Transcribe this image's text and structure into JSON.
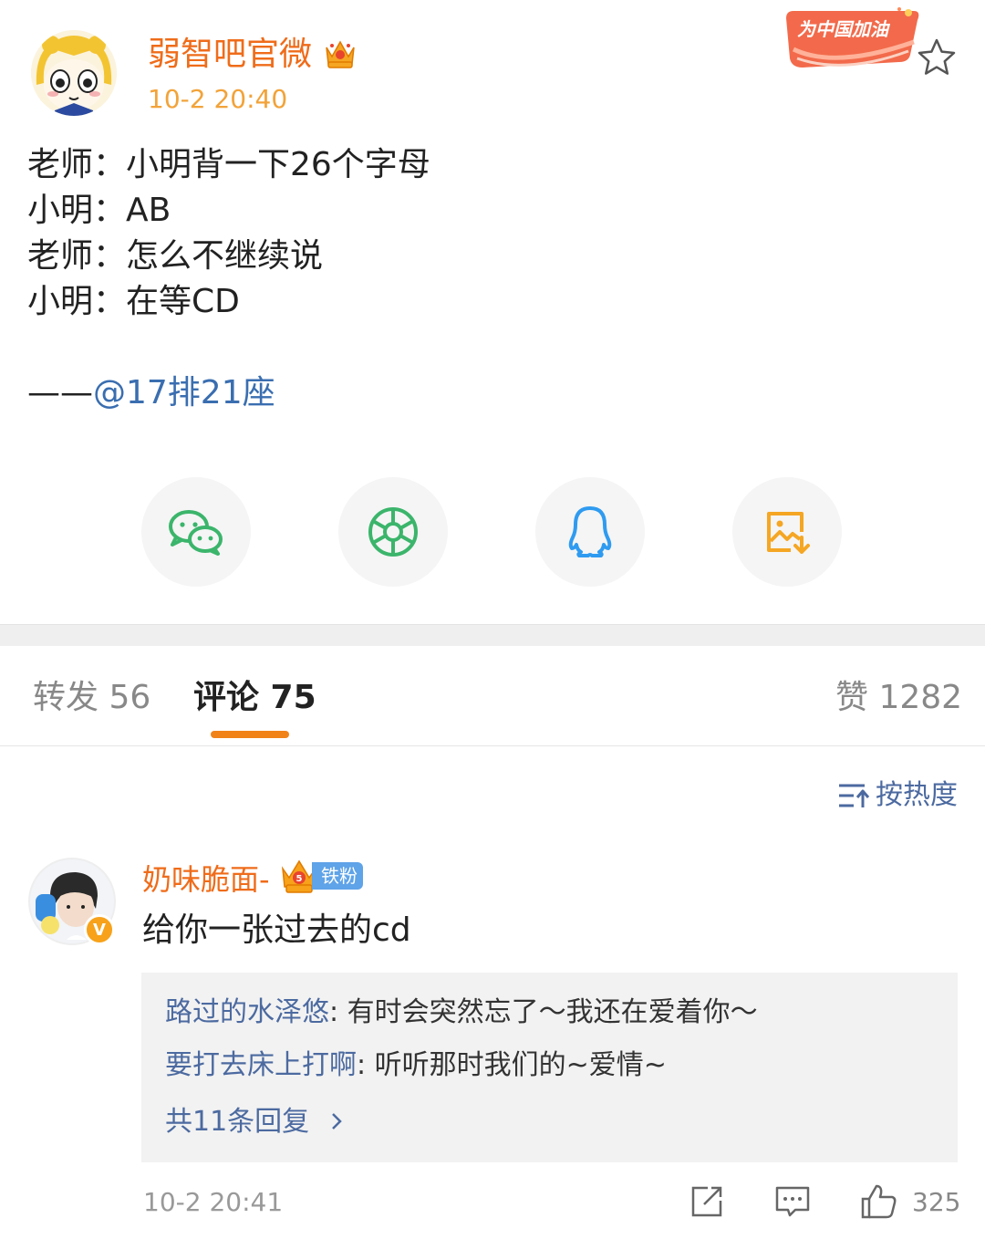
{
  "post": {
    "author_name": "弱智吧官微",
    "time": "10-2 20:40",
    "promo_badge": "为中国加油",
    "lines": [
      "老师：小明背一下26个字母",
      "小明：AB",
      "老师：怎么不继续说",
      "小明：在等CD"
    ],
    "attribution_prefix": "——",
    "attribution_mention": "@17排21座"
  },
  "share": {
    "items": [
      {
        "name": "wechat",
        "color": "#3bb56b"
      },
      {
        "name": "moments",
        "color": "#3bb56b"
      },
      {
        "name": "qq",
        "color": "#2f9bf0"
      },
      {
        "name": "save-image",
        "color": "#f5a623"
      }
    ]
  },
  "tabs": {
    "repost": "转发 56",
    "comments": "评论 75",
    "likes": "赞 1282"
  },
  "sort": {
    "label": "按热度"
  },
  "comment": {
    "author": "奶味脆面-",
    "fan_level": "5",
    "fan_badge": "铁粉",
    "verified": "V",
    "text": "给你一张过去的cd",
    "replies": [
      {
        "name": "路过的水泽悠",
        "text": ": 有时会突然忘了～我还在爱着你～"
      },
      {
        "name": "要打去床上打啊",
        "text": ": 听听那时我们的~爱情~"
      }
    ],
    "more_replies": "共11条回复",
    "time": "10-2 20:41",
    "like_count": "325"
  },
  "colors": {
    "accent_orange": "#ef6c1a",
    "link_blue": "#4c6aa0",
    "tab_indicator": "#f08218"
  }
}
